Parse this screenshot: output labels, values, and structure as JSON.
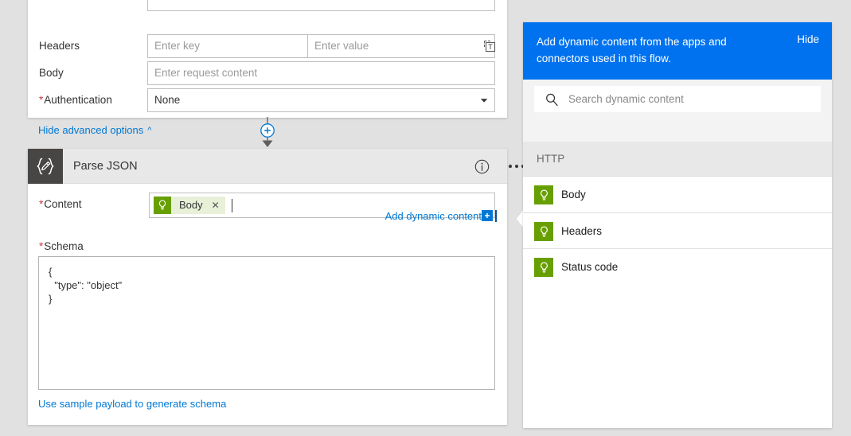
{
  "theme": {
    "canvas_bg": "#e1e1e1",
    "accent_blue": "#0078d4",
    "banner_blue": "#0072ef",
    "token_green": "#689f00",
    "token_chip_bg": "#e8f0d8",
    "card_header_gray": "#e8e8e8",
    "icon_tile_dark": "#484644",
    "required_red": "#d13438"
  },
  "http_card": {
    "rows": [
      {
        "id": "headers",
        "label": "Headers",
        "required": false,
        "key_placeholder": "Enter key",
        "value_placeholder": "Enter value"
      },
      {
        "id": "body",
        "label": "Body",
        "required": false,
        "placeholder": "Enter request content"
      },
      {
        "id": "authentication",
        "label": "Authentication",
        "required": true,
        "value": "None"
      }
    ],
    "advanced_options_link": "Hide advanced options",
    "token_picker_icon": "insert-token-icon",
    "chevron_icon": "chevron-down-icon",
    "caret_icon": "chevron-up-icon"
  },
  "connector": {
    "add_step_icon": "plus-circle-icon",
    "arrow_icon": "arrow-down-icon"
  },
  "parse_card": {
    "icon": "json-braces-pencil-icon",
    "title": "Parse JSON",
    "info_icon": "info-circle-icon",
    "menu_icon": "ellipsis-icon",
    "content_field": {
      "label": "Content",
      "required": true,
      "token": {
        "label": "Body",
        "icon": "lightbulb-token-icon",
        "remove_icon": "close-icon"
      }
    },
    "add_dynamic_content_link": "Add dynamic content",
    "add_dynamic_content_icon": "dynamic-content-icon",
    "schema_field": {
      "label": "Schema",
      "required": true,
      "value": "{\n  \"type\": \"object\"\n}"
    },
    "sample_payload_link": "Use sample payload to generate schema"
  },
  "dynamic_panel": {
    "banner_text": "Add dynamic content from the apps and connectors used in this flow.",
    "hide_label": "Hide",
    "search": {
      "placeholder": "Search dynamic content",
      "value": "",
      "icon": "search-icon"
    },
    "groups": [
      {
        "name": "HTTP",
        "items": [
          {
            "label": "Body",
            "icon": "lightbulb-token-icon"
          },
          {
            "label": "Headers",
            "icon": "lightbulb-token-icon"
          },
          {
            "label": "Status code",
            "icon": "lightbulb-token-icon"
          }
        ]
      }
    ]
  }
}
